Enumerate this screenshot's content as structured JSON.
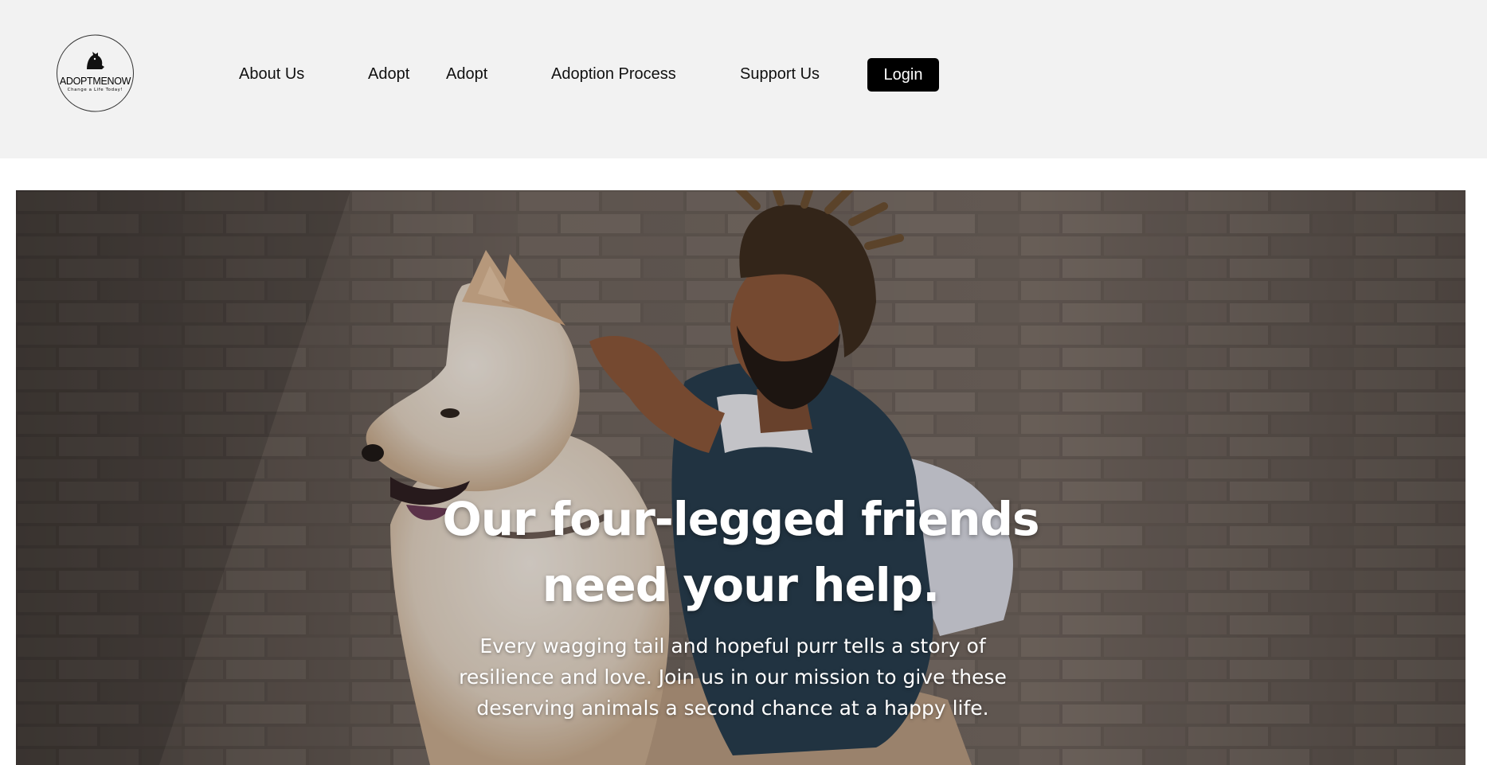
{
  "logo": {
    "name": "ADOPTMENOW",
    "tagline": "Change a Life Today!"
  },
  "nav": {
    "items": [
      {
        "label": "About Us"
      },
      {
        "label": "Adopt"
      },
      {
        "label": "Adopt"
      },
      {
        "label": "Adoption Process"
      },
      {
        "label": "Support Us"
      }
    ],
    "login_label": "Login"
  },
  "hero": {
    "title_line1": "Our four-legged friends",
    "title_line2": "need your help.",
    "subtitle": "Every wagging tail and hopeful purr tells a story of resilience and love. Join us in our mission to give these deserving animals a second chance at a happy life.",
    "image_description_icon": "man-with-dog-photo"
  },
  "colors": {
    "header_bg": "#f2f2f2",
    "login_bg": "#000000",
    "login_text": "#ffffff",
    "hero_text": "#ffffff"
  }
}
